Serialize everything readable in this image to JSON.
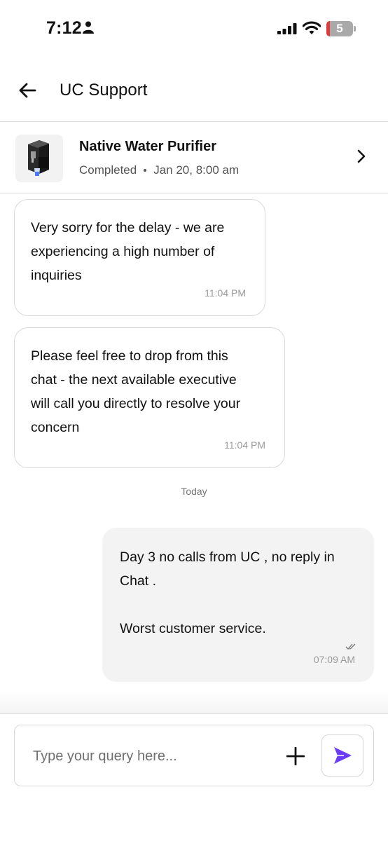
{
  "status_bar": {
    "time": "7:12",
    "battery_level": "5",
    "icons": [
      "person-icon",
      "cellular-signal-icon",
      "wifi-icon",
      "battery-icon"
    ]
  },
  "header": {
    "title": "UC Support",
    "back_icon": "arrow-left-icon"
  },
  "booking": {
    "name": "Native Water Purifier",
    "status": "Completed",
    "date": "Jan 20, 8:00 am",
    "thumb_icon": "water-purifier-icon",
    "chevron_icon": "chevron-right-icon"
  },
  "messages": [
    {
      "direction": "incoming",
      "lines": [
        "Very sorry for the delay - we are",
        "experiencing a high number of",
        "inquiries"
      ],
      "time": "11:04 PM"
    },
    {
      "direction": "incoming",
      "lines": [
        "Please feel free to drop from this",
        "chat - the next available executive",
        "will call you directly to resolve your",
        "concern"
      ],
      "time": "11:04 PM"
    },
    {
      "direction": "outgoing",
      "lines": [
        "Day 3 no calls from UC , no reply in",
        "Chat .",
        "",
        "Worst customer service."
      ],
      "time": "07:09 AM",
      "read_icon": "double-check-icon"
    }
  ],
  "day_separator": "Today",
  "composer": {
    "placeholder": "Type your query here...",
    "value": "",
    "plus_icon": "plus-icon",
    "send_icon": "send-icon"
  },
  "colors": {
    "accent": "#6a3cf5",
    "outgoing_bubble": "#f3f3f3",
    "border": "#d9d9d9",
    "timestamp": "#9a9a9a",
    "battery_low": "#e03a3a"
  }
}
